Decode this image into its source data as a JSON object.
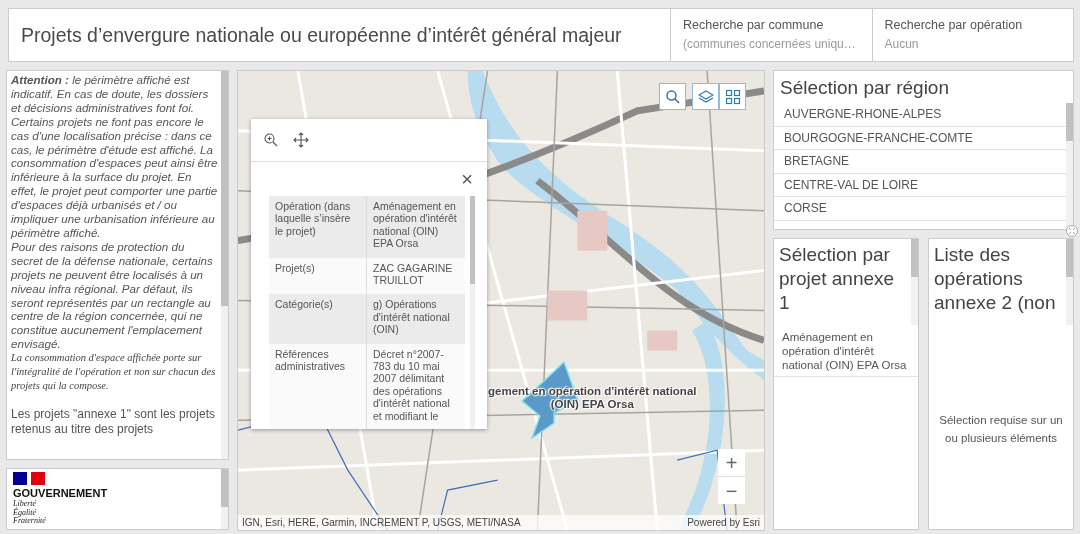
{
  "header": {
    "title": "Projets d’envergure nationale ou européenne d’intérêt général majeur",
    "filters": [
      {
        "label": "Recherche par commune",
        "placeholder": "(communes concernées uniqu…"
      },
      {
        "label": "Recherche par opération",
        "placeholder": "Aucun"
      }
    ]
  },
  "notice": {
    "paragraphs": [
      {
        "kind": "italic",
        "text": "**Attention :** le périmètre affiché est indicatif. En cas de doute, les dossiers et décisions administratives font foi. Certains projets ne font pas encore le cas d'une localisation précise : dans ce cas, le périmètre d'étude est affiché. La consommation d'espaces peut ainsi être inférieure à la surface du projet. En effet, le projet peut comporter une partie d'espaces déjà urbanisés et / ou impliquer une urbanisation inférieure au périmètre affiché."
      },
      {
        "kind": "italic",
        "text": "Pour des raisons de protection du secret de la défense nationale, certains projets ne peuvent être localisés à un niveau infra régional. Par défaut, ils seront représentés par un rectangle au centre de la région concernée, qui ne constitue aucunement l'emplacement envisagé."
      },
      {
        "kind": "serif",
        "text": "La consommation d'espace affichée porte sur l'intégralité de l'opération et non sur chacun des projets qui la compose."
      },
      {
        "kind": "plain",
        "text": "Les projets \"annexe 1\" sont les projets retenus au titre des projets"
      }
    ]
  },
  "logo": {
    "name": "GOUVERNEMENT",
    "motto": [
      "Liberté",
      "Égalité",
      "Fraternité"
    ]
  },
  "map": {
    "feature_label": [
      "gement en opération d'intérêt national",
      "(OIN) EPA Orsa"
    ],
    "attribution": "IGN, Esri, HERE, Garmin, INCREMENT P, USGS, METI/NASA",
    "powered_by": "Powered by Esri",
    "zoom_in": "+",
    "zoom_out": "−",
    "popup": {
      "close": "×",
      "rows": [
        {
          "label": "Opération (dans laquelle s’insère le projet)",
          "value": "Aménagement en opération d'intérêt national (OIN) EPA Orsa"
        },
        {
          "label": "Projet(s)",
          "value": "ZAC GAGARINE TRUILLOT"
        },
        {
          "label": "Catégorie(s)",
          "value": "g) Opérations d'intérêt national (OIN)"
        },
        {
          "label": "Références administratives",
          "value": "Décret n°2007-783 du 10 mai 2007 délimitant des opérations d'intérêt national et modifiant le"
        }
      ]
    }
  },
  "regions": {
    "title": "Sélection par région",
    "items": [
      "AUVERGNE-RHONE-ALPES",
      "BOURGOGNE-FRANCHE-COMTE",
      "BRETAGNE",
      "CENTRE-VAL DE LOIRE",
      "CORSE"
    ]
  },
  "annexe1": {
    "title": "Sélection par projet annexe 1",
    "items": [
      "Aménagement en opération d'intérêt national (OIN) EPA Orsa"
    ]
  },
  "annexe2": {
    "title": "Liste des opérations annexe 2 (non",
    "empty_message": "Sélection requise sur un ou plusieurs éléments"
  }
}
